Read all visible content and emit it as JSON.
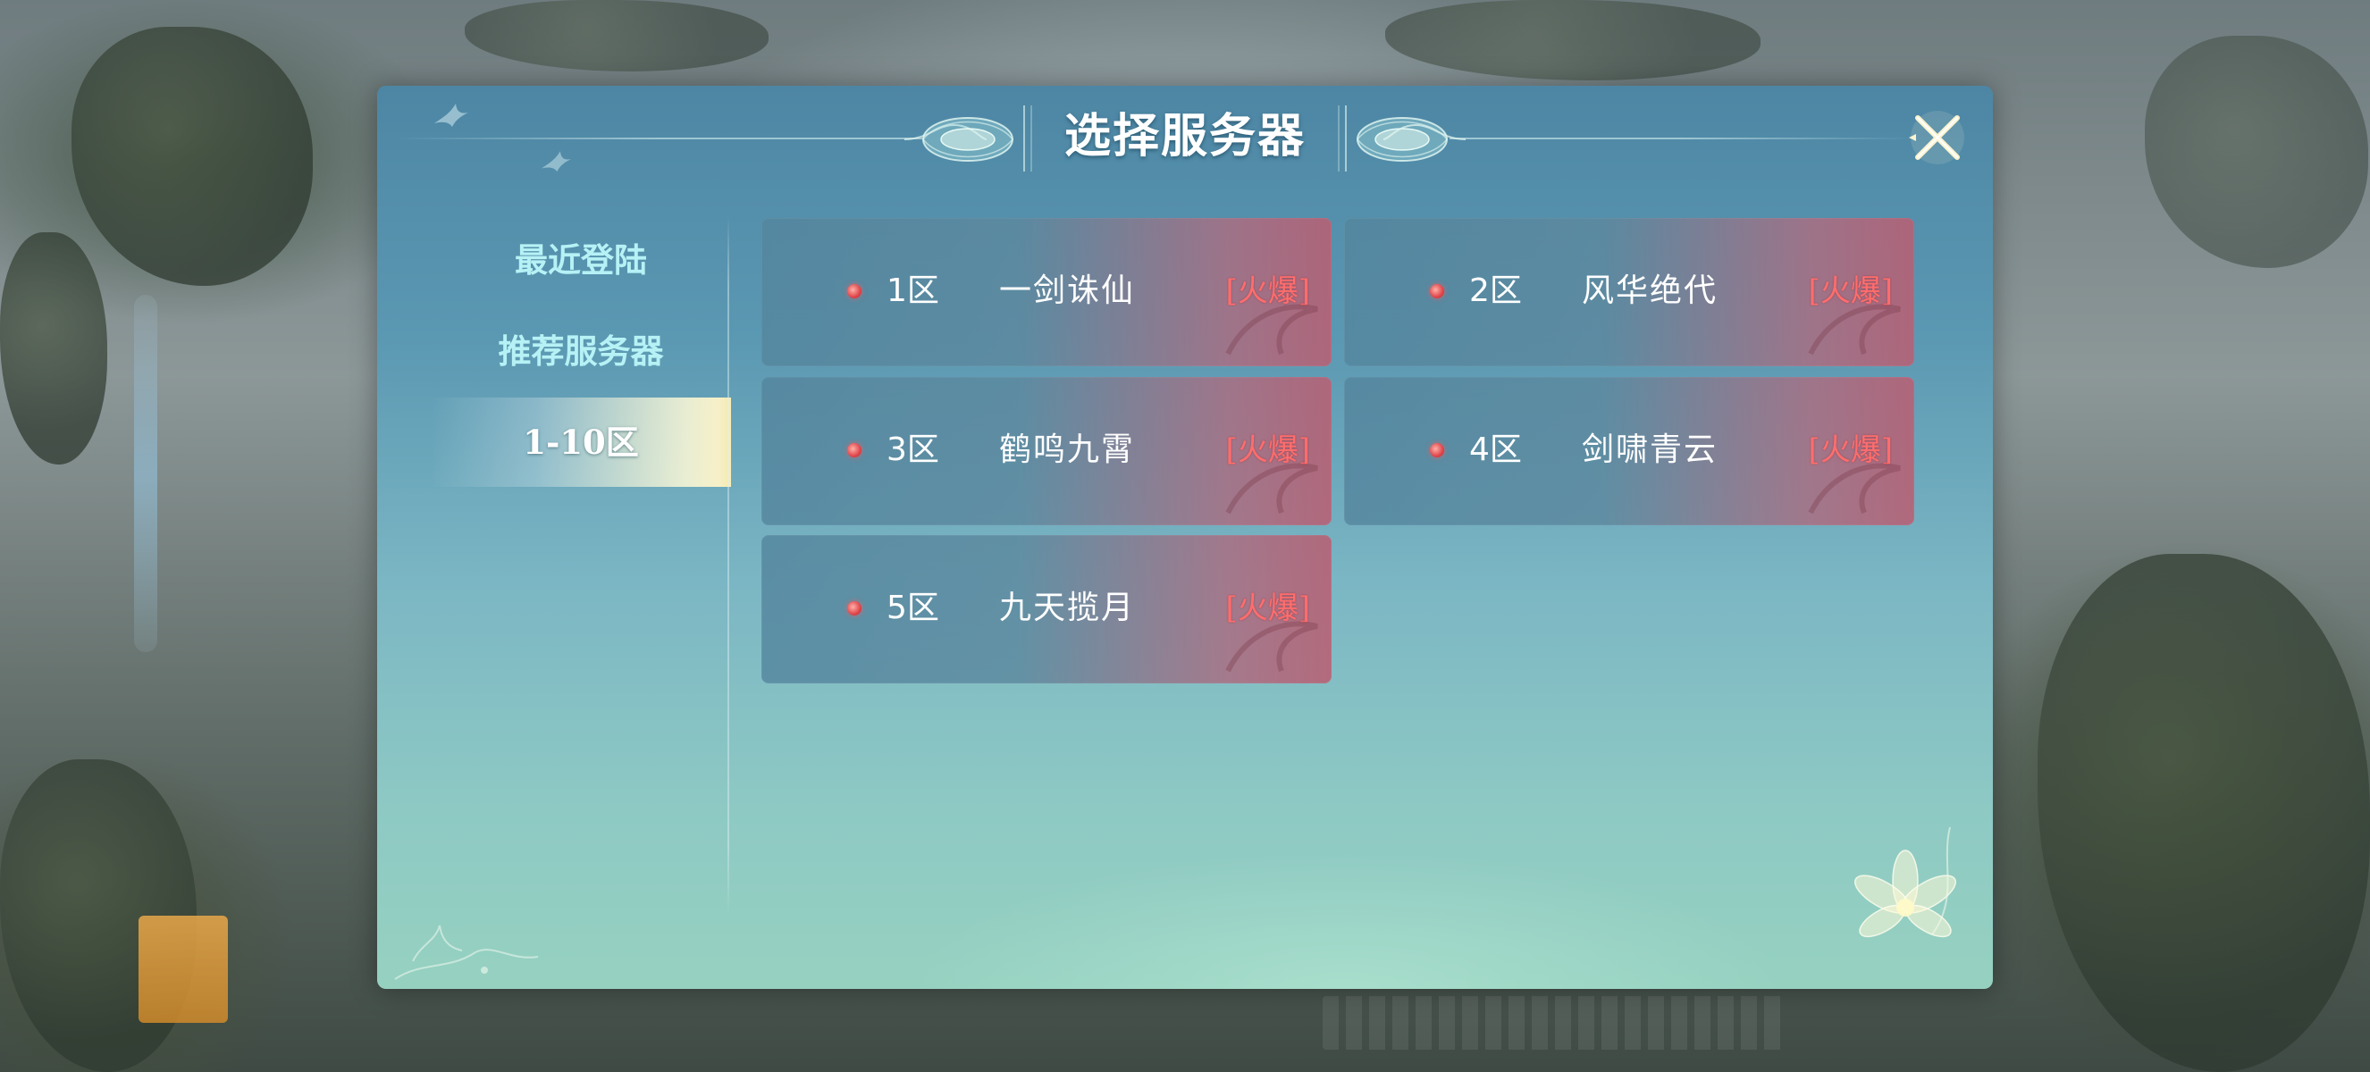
{
  "dialog": {
    "title": "选择服务器"
  },
  "sidebar": {
    "items": [
      {
        "label": "最近登陆",
        "active": false
      },
      {
        "label": "推荐服务器",
        "active": false
      },
      {
        "label": "1-10区",
        "active": true
      }
    ]
  },
  "servers": [
    {
      "zone": "1区",
      "name": "一剑诛仙",
      "status": "[火爆]"
    },
    {
      "zone": "2区",
      "name": "风华绝代",
      "status": "[火爆]"
    },
    {
      "zone": "3区",
      "name": "鹤鸣九霄",
      "status": "[火爆]"
    },
    {
      "zone": "4区",
      "name": "剑啸青云",
      "status": "[火爆]"
    },
    {
      "zone": "5区",
      "name": "九天揽月",
      "status": "[火爆]"
    }
  ],
  "colors": {
    "status_hot": "#ff6d6d",
    "sidebar_text": "#b6f2f5",
    "active_highlight": "#f4e9ae",
    "status_dot": "#e0454a"
  }
}
